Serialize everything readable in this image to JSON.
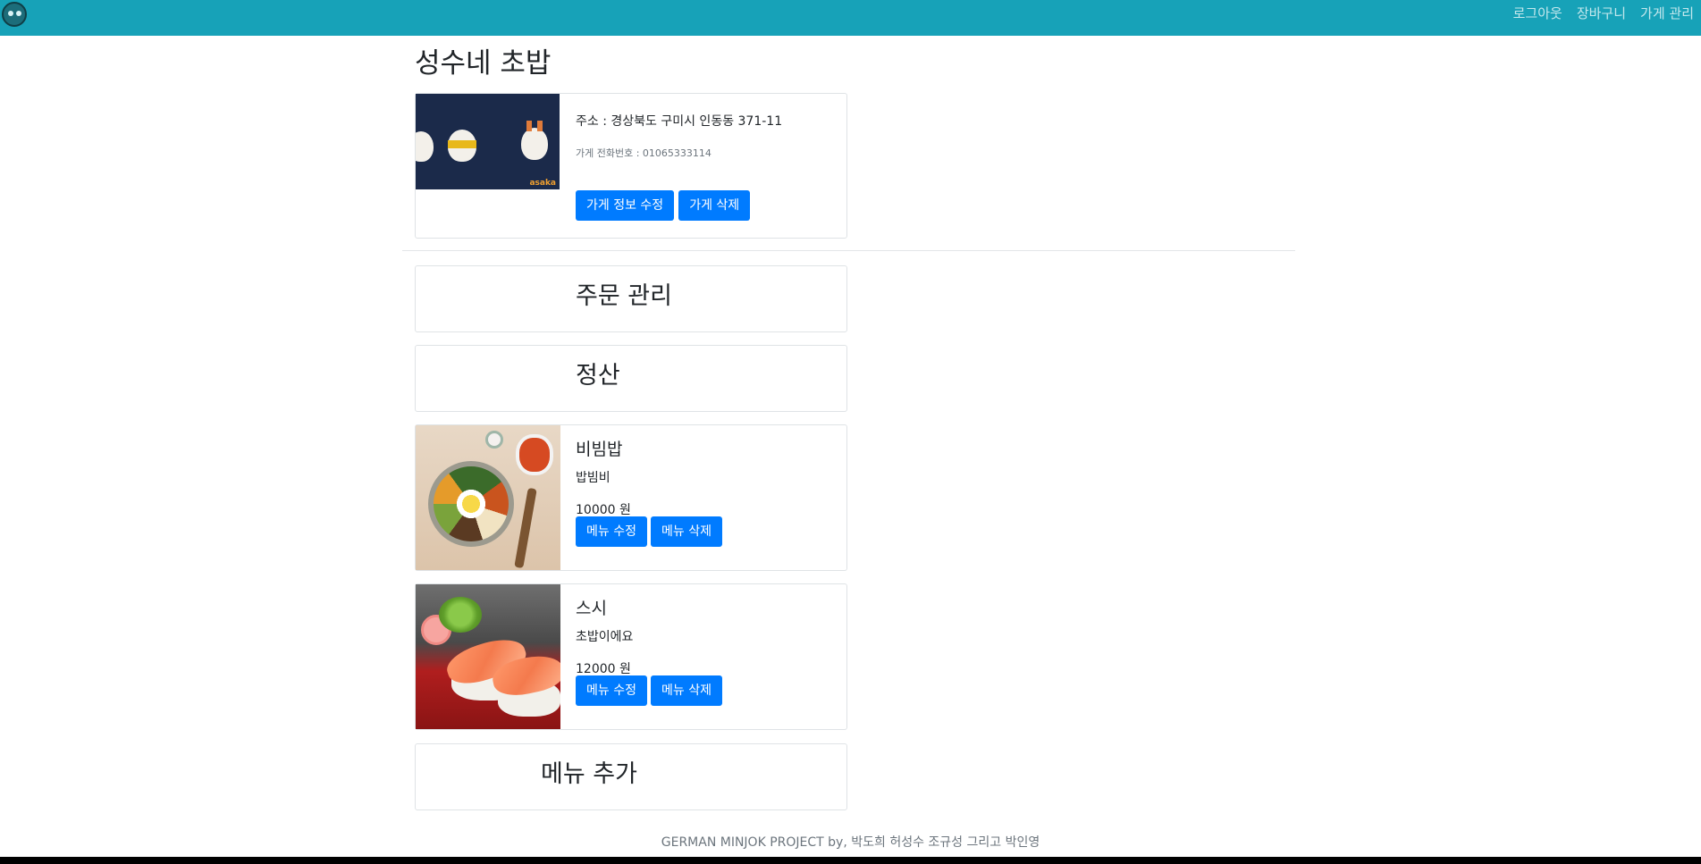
{
  "nav": {
    "links": [
      "로그아웃",
      "장바구니",
      "가게 관리"
    ]
  },
  "store": {
    "name": "성수네 초밥",
    "address": "주소 : 경상북도 구미시 인동동 371-11",
    "phone": "가게 전화번호 : 01065333114",
    "edit_label": "가게 정보 수정",
    "delete_label": "가게 삭제",
    "image_tag": "asaka"
  },
  "actions": {
    "orders_label": "주문 관리",
    "settlement_label": "정산",
    "add_menu_label": "메뉴 추가"
  },
  "menus": [
    {
      "name": "비빔밥",
      "description": "밥빔비",
      "price": "10000 원",
      "edit_label": "메뉴 수정",
      "delete_label": "메뉴 삭제"
    },
    {
      "name": "스시",
      "description": "초밥이에요",
      "price": "12000 원",
      "edit_label": "메뉴 수정",
      "delete_label": "메뉴 삭제"
    }
  ],
  "footer": {
    "text": "GERMAN MINJOK PROJECT by, 박도희 허성수 조규성 그리고 박인영"
  },
  "colors": {
    "navbar": "#17a2b8",
    "primary_button": "#007bff"
  }
}
